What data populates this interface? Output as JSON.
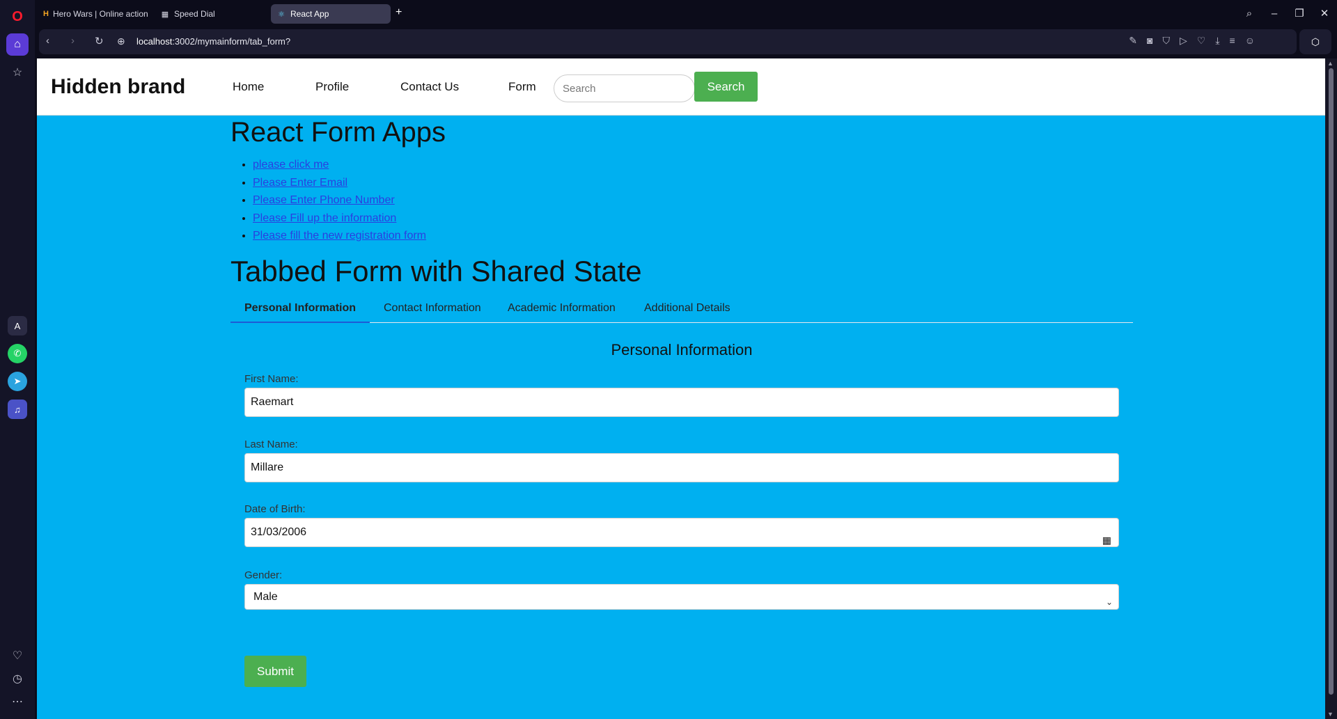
{
  "browser": {
    "tabs": [
      {
        "title": "Hero Wars | Online action",
        "icon": "hero-wars-icon"
      },
      {
        "title": "Speed Dial",
        "icon": "speed-dial-icon"
      },
      {
        "title": "React App",
        "icon": "react-icon"
      }
    ],
    "url_host": "localhost",
    "url_rest": ":3002/mymainform/tab_form?"
  },
  "navbar": {
    "brand": "Hidden brand",
    "links": [
      "Home",
      "Profile",
      "Contact Us",
      "Form"
    ],
    "search_placeholder": "Search",
    "search_button": "Search"
  },
  "page": {
    "title": "React Form Apps",
    "links": [
      "please click me",
      "Please Enter Email",
      "Please Enter Phone Number",
      "Please Fill up the information",
      "Please fill the new registration form"
    ],
    "tabbed_title": "Tabbed Form with Shared State",
    "tabs": [
      "Personal Information",
      "Contact Information",
      "Academic Information",
      "Additional Details"
    ],
    "active_tab": "Personal Information"
  },
  "form": {
    "section_title": "Personal Information",
    "first_name_label": "First Name:",
    "first_name_value": "Raemart",
    "last_name_label": "Last Name:",
    "last_name_value": "Millare",
    "dob_label": "Date of Birth:",
    "dob_value": "31/03/2006",
    "gender_label": "Gender:",
    "gender_value": "Male",
    "submit_label": "Submit"
  },
  "colors": {
    "page_background": "#00b0f0",
    "button_green": "#4caf50",
    "link_blue": "#2a3fe0"
  }
}
